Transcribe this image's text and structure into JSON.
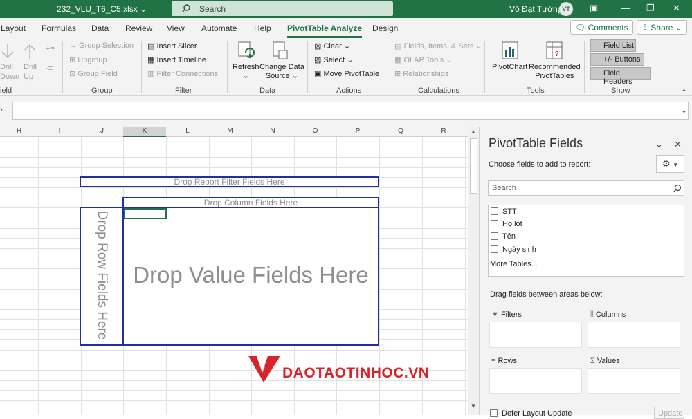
{
  "titlebar": {
    "filename": "232_VLU_T6_C5.xlsx",
    "search_placeholder": "Search",
    "user_name": "Võ Đạt Tường",
    "user_initials": "VT"
  },
  "tabs": [
    {
      "label": "Layout"
    },
    {
      "label": "Formulas"
    },
    {
      "label": "Data"
    },
    {
      "label": "Review"
    },
    {
      "label": "View"
    },
    {
      "label": "Automate"
    },
    {
      "label": "Help"
    },
    {
      "label": "PivotTable Analyze",
      "active": true
    },
    {
      "label": "Design"
    }
  ],
  "comments_label": "Comments",
  "share_label": "Share",
  "ribbon": {
    "field_group": {
      "drill_down": "Drill\nDown",
      "drill_up": "Drill\nUp",
      "label": "ield"
    },
    "group": {
      "group_selection": "Group Selection",
      "ungroup": "Ungroup",
      "group_field": "Group Field",
      "label": "Group"
    },
    "filter": {
      "insert_slicer": "Insert Slicer",
      "insert_timeline": "Insert Timeline",
      "filter_connections": "Filter Connections",
      "label": "Filter"
    },
    "data": {
      "refresh": "Refresh",
      "change_data_source": "Change Data\nSource",
      "label": "Data"
    },
    "actions": {
      "clear": "Clear",
      "select": "Select",
      "move_pivot": "Move PivotTable",
      "label": "Actions"
    },
    "calculations": {
      "fields_items_sets": "Fields, Items, & Sets",
      "olap_tools": "OLAP Tools",
      "relationships": "Relationships",
      "label": "Calculations"
    },
    "tools": {
      "pivotchart": "PivotChart",
      "recommended": "Recommended\nPivotTables",
      "label": "Tools"
    },
    "show": {
      "field_list": "Field List",
      "buttons": "+/- Buttons",
      "field_headers": "Field Headers",
      "label": "Show"
    }
  },
  "grid": {
    "columns": [
      "H",
      "I",
      "J",
      "K",
      "L",
      "M",
      "N",
      "O",
      "P",
      "Q",
      "R"
    ],
    "drop_filter": "Drop Report Filter Fields Here",
    "drop_column": "Drop Column Fields Here",
    "drop_row": "Drop Row Fields Here",
    "drop_value": "Drop Value Fields Here"
  },
  "watermark": "DAOTAOTINHOC.VN",
  "pane": {
    "title": "PivotTable Fields",
    "subtitle": "Choose fields to add to report:",
    "search_placeholder": "Search",
    "fields": [
      "STT",
      "Họ lót",
      "Tên",
      "Ngày sinh"
    ],
    "more_tables": "More Tables...",
    "drag_hint": "Drag fields between areas below:",
    "filters": "Filters",
    "columns": "Columns",
    "rows": "Rows",
    "values": "Values",
    "defer": "Defer Layout Update",
    "update": "Update"
  },
  "colors": {
    "excel_green": "#217346",
    "pivot_border": "#1f2fa5",
    "watermark_red": "#d9232a"
  }
}
